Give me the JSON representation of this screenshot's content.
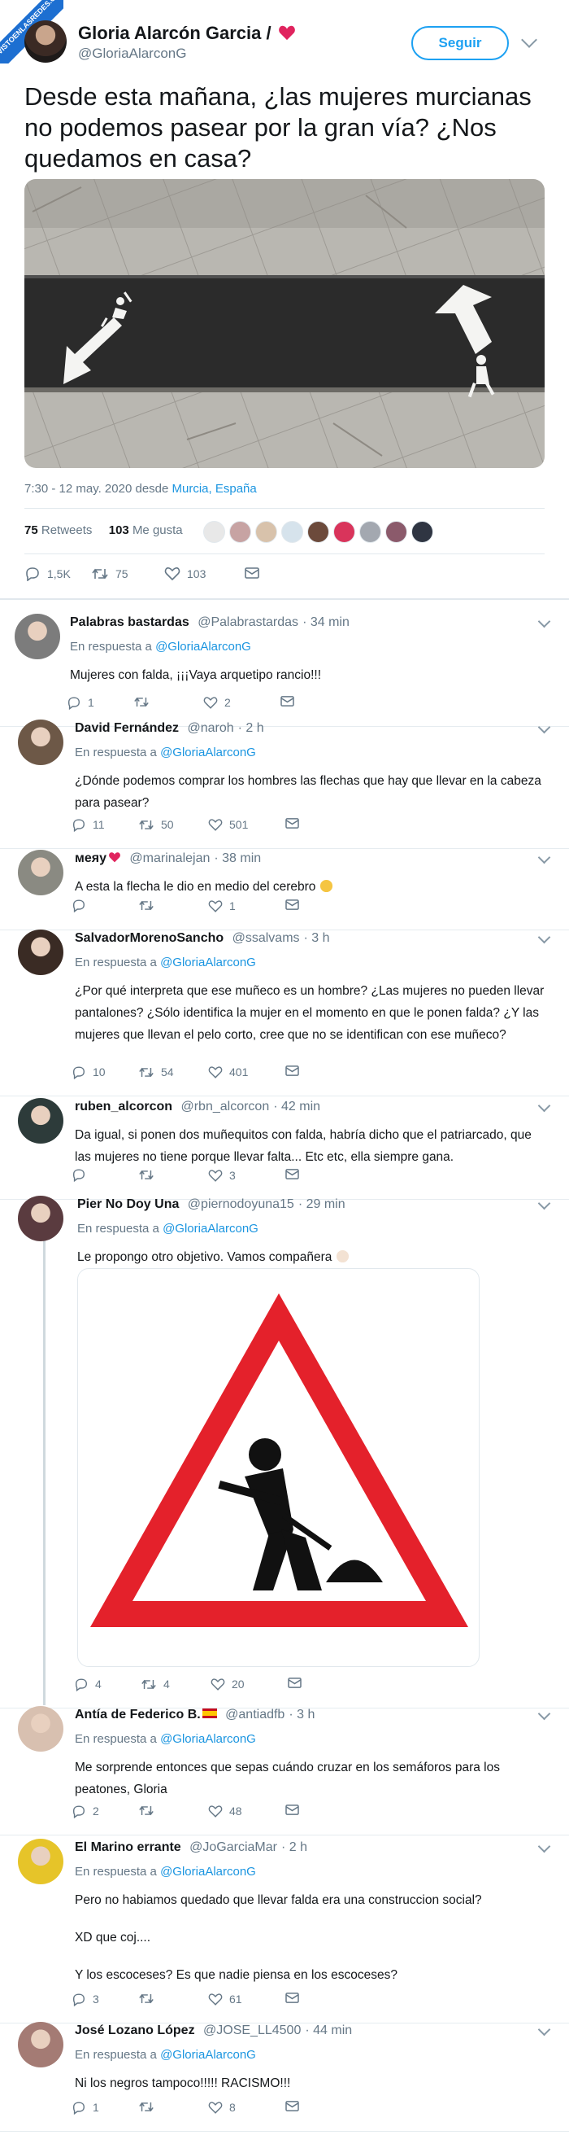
{
  "tweet": {
    "author_name": "Gloria Alarcón Garcia /",
    "author_handle": "@GloriaAlarconG",
    "follow_label": "Seguir",
    "text": "Desde esta mañana, ¿las mujeres murcianas no podemos pasear por la gran vía? ¿Nos quedamos en casa?",
    "timestamp": "7:30 - 12 may. 2020 desde ",
    "location": "Murcia, España",
    "retweets_count": "75",
    "retweets_label": "Retweets",
    "likes_count": "103",
    "likes_label": "Me gusta",
    "actions": {
      "replies": "1,5K",
      "retweets": "75",
      "likes": "103"
    }
  },
  "badge_text": "VISTOENLASREDES.COM",
  "reply_prefix": "En respuesta a",
  "reply_target": "@GloriaAlarconG",
  "replies": [
    {
      "name": "Palabras bastardas",
      "handle": "@Palabrastardas",
      "time": "· 34 min",
      "text": "Mujeres con falda, ¡¡¡Vaya arquetipo rancio!!!",
      "stats": [
        "1",
        "",
        "2"
      ]
    },
    {
      "name": "David Fernández",
      "handle": "@naroh",
      "time": "· 2 h",
      "text": "¿Dónde podemos comprar los hombres las flechas que hay que llevar en la cabeza para pasear?",
      "stats": [
        "11",
        "50",
        "501"
      ]
    },
    {
      "name": "меяу",
      "handle": "@marinalejan",
      "time": "· 38 min",
      "text": "A esta la flecha le dio en medio del cerebro",
      "stats": [
        "",
        "",
        "1"
      ]
    },
    {
      "name": "SalvadorMorenoSancho",
      "handle": "@ssalvams",
      "time": "· 3 h",
      "text": "¿Por qué interpreta que ese muñeco es un hombre? ¿Las mujeres no pueden llevar pantalones? ¿Sólo identifica la mujer en el momento en que le ponen falda? ¿Y las mujeres que llevan el pelo corto, cree que no se identifican con ese muñeco?",
      "stats": [
        "10",
        "54",
        "401"
      ]
    },
    {
      "name": "ruben_alcorcon",
      "handle": "@rbn_alcorcon",
      "time": "· 42 min",
      "text": "Da igual, si ponen dos muñequitos con falda, habría dicho que el patriarcado, que las mujeres no tiene porque llevar falta... Etc etc, ella siempre gana.",
      "stats": [
        "",
        "",
        "3"
      ]
    },
    {
      "name": "Pier No Doy Una",
      "handle": "@piernodoyuna15",
      "time": "· 29 min",
      "text": "Le propongo otro objetivo. Vamos compañera",
      "stats": [
        "4",
        "4",
        "20"
      ]
    },
    {
      "name": "Antía de Federico B.",
      "handle": "@antiadfb",
      "time": "· 3 h",
      "text": "Me sorprende entonces que sepas cuándo cruzar en los semáforos para los peatones, Gloria",
      "stats": [
        "2",
        "",
        "48"
      ]
    },
    {
      "name": "El Marino errante",
      "handle": "@JoGarciaMar",
      "time": "· 2 h",
      "text_lines": [
        "Pero no habiamos quedado que llevar falda era una construccion social?",
        "XD que coj....",
        "Y los escoceses? Es que nadie piensa en los escoceses?"
      ],
      "stats": [
        "3",
        "",
        "61"
      ]
    },
    {
      "name": "José Lozano López",
      "handle": "@JOSE_LL4500",
      "time": "· 44 min",
      "text": "Ni los negros tampoco!!!!! RACISMO!!!",
      "stats": [
        "1",
        "",
        "8"
      ]
    }
  ],
  "colors": {
    "link": "#1b95e0",
    "follow": "#1da1f2",
    "muted": "#657786",
    "thread": "#cfd9de"
  }
}
